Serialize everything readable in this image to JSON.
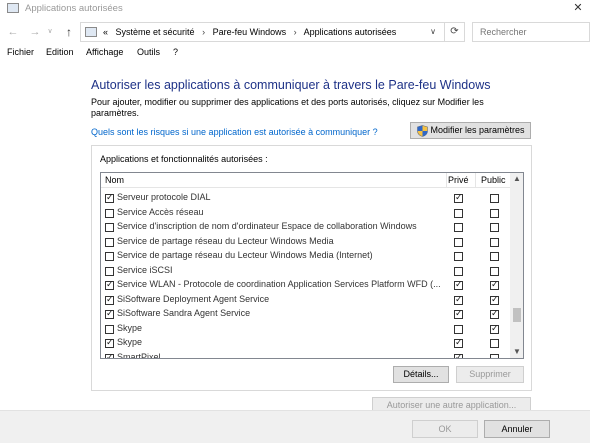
{
  "window": {
    "title": "Applications autorisées",
    "close_glyph": "✕"
  },
  "address": {
    "prefix": "«",
    "crumbs": [
      "Système et sécurité",
      "Pare-feu Windows",
      "Applications autorisées"
    ],
    "separator": "›",
    "refresh_glyph": "⟳"
  },
  "search": {
    "placeholder": "Rechercher"
  },
  "menu": [
    "Fichier",
    "Edition",
    "Affichage",
    "Outils",
    "?"
  ],
  "heading": "Autoriser les applications à communiquer à travers le Pare-feu Windows",
  "description": "Pour ajouter, modifier ou supprimer des applications et des ports autorisés, cliquez sur Modifier les paramètres.",
  "risk_link": "Quels sont les risques si une application est autorisée à communiquer ?",
  "modify_button": "Modifier les paramètres",
  "group_title": "Applications et fonctionnalités autorisées :",
  "columns": {
    "name": "Nom",
    "private": "Privé",
    "public": "Public"
  },
  "rows": [
    {
      "enabled": true,
      "name": "Serveur protocole DIAL",
      "private": true,
      "public": false
    },
    {
      "enabled": false,
      "name": "Service Accès réseau",
      "private": false,
      "public": false
    },
    {
      "enabled": false,
      "name": "Service d'inscription de nom d'ordinateur Espace de collaboration Windows",
      "private": false,
      "public": false
    },
    {
      "enabled": false,
      "name": "Service de partage réseau du Lecteur Windows Media",
      "private": false,
      "public": false
    },
    {
      "enabled": false,
      "name": "Service de partage réseau du Lecteur Windows Media (Internet)",
      "private": false,
      "public": false
    },
    {
      "enabled": false,
      "name": "Service iSCSI",
      "private": false,
      "public": false
    },
    {
      "enabled": true,
      "name": "Service WLAN - Protocole de coordination Application Services Platform WFD (...",
      "private": true,
      "public": true
    },
    {
      "enabled": true,
      "name": "SiSoftware Deployment Agent Service",
      "private": true,
      "public": true
    },
    {
      "enabled": true,
      "name": "SiSoftware Sandra Agent Service",
      "private": true,
      "public": true
    },
    {
      "enabled": false,
      "name": "Skype",
      "private": false,
      "public": true
    },
    {
      "enabled": true,
      "name": "Skype",
      "private": true,
      "public": false
    },
    {
      "enabled": true,
      "name": "SmartPixel",
      "private": true,
      "public": false
    }
  ],
  "details_button": "Détails...",
  "remove_button": "Supprimer",
  "allow_other_button": "Autoriser une autre application...",
  "ok_button": "OK",
  "cancel_button": "Annuler",
  "colors": {
    "heading": "#1e3287",
    "link": "#0066cc"
  }
}
